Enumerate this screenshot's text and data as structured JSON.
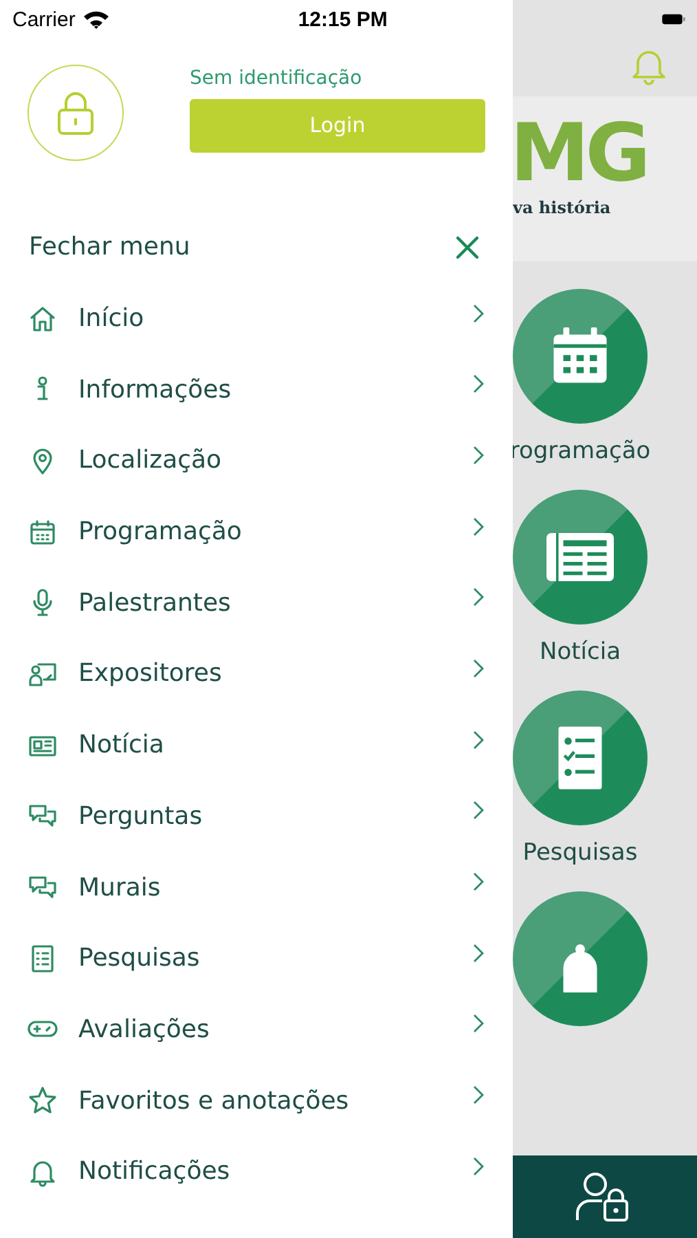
{
  "status_bar": {
    "carrier": "Carrier",
    "time": "12:15 PM"
  },
  "drawer": {
    "user_status": "Sem identificação",
    "login_button": "Login",
    "close_label": "Fechar menu",
    "items": [
      {
        "label": "Início",
        "kind": "home"
      },
      {
        "label": "Informações",
        "kind": "info"
      },
      {
        "label": "Localização",
        "kind": "pin"
      },
      {
        "label": "Programação",
        "kind": "calendar"
      },
      {
        "label": "Palestrantes",
        "kind": "mic"
      },
      {
        "label": "Expositores",
        "kind": "exhibitor"
      },
      {
        "label": "Notícia",
        "kind": "news"
      },
      {
        "label": "Perguntas",
        "kind": "chat"
      },
      {
        "label": "Murais",
        "kind": "chat"
      },
      {
        "label": "Pesquisas",
        "kind": "list"
      },
      {
        "label": "Avaliações",
        "kind": "gamepad"
      },
      {
        "label": "Favoritos e anotações",
        "kind": "star"
      },
      {
        "label": "Notificações",
        "kind": "bell"
      }
    ]
  },
  "background": {
    "logo_text": "MG",
    "logo_tagline": "va história",
    "tiles": [
      {
        "label": "rogramação",
        "kind": "calendar"
      },
      {
        "label": "Notícia",
        "kind": "news"
      },
      {
        "label": "Pesquisas",
        "kind": "checklist"
      },
      {
        "kind": "bell"
      }
    ]
  }
}
